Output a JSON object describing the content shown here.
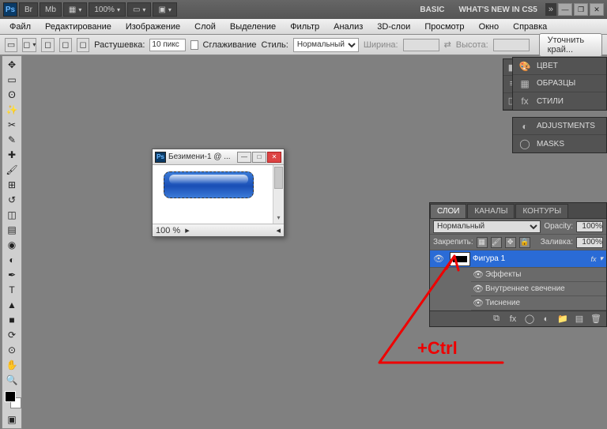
{
  "topbar": {
    "ps": "Ps",
    "br": "Br",
    "mb": "Mb",
    "zoom": "100%",
    "workspace": "BASIC",
    "whatsnew": "WHAT'S NEW IN CS5"
  },
  "menu": {
    "file": "Файл",
    "edit": "Редактирование",
    "image": "Изображение",
    "layer": "Слой",
    "select": "Выделение",
    "filter": "Фильтр",
    "analysis": "Анализ",
    "threeD": "3D-слои",
    "view": "Просмотр",
    "window": "Окно",
    "help": "Справка"
  },
  "opts": {
    "feather_lbl": "Растушевка:",
    "feather_val": "10 пикс",
    "antialias": "Сглаживание",
    "style_lbl": "Стиль:",
    "style_val": "Нормальный",
    "width_lbl": "Ширина:",
    "width_val": "",
    "height_lbl": "Высота:",
    "height_val": "",
    "refine": "Уточнить край..."
  },
  "doc": {
    "title": "Безимени-1 @ ...",
    "zoom": "100 %"
  },
  "dock": {
    "color": "ЦВЕТ",
    "swatches": "ОБРАЗЦЫ",
    "styles": "СТИЛИ",
    "adjustments": "ADJUSTMENTS",
    "masks": "MASKS"
  },
  "layers": {
    "tab_layers": "СЛОИ",
    "tab_channels": "КАНАЛЫ",
    "tab_paths": "КОНТУРЫ",
    "blend": "Нормальный",
    "opacity_lbl": "Opacity:",
    "opacity_val": "100%",
    "lock_lbl": "Закрепить:",
    "fill_lbl": "Заливка:",
    "fill_val": "100%",
    "item": "Фигура 1",
    "fx": "fx",
    "effects": "Эффекты",
    "inner_glow": "Внутреннее свечение",
    "bevel": "Тиснение"
  },
  "annot": {
    "ctrl": "+Ctrl"
  }
}
